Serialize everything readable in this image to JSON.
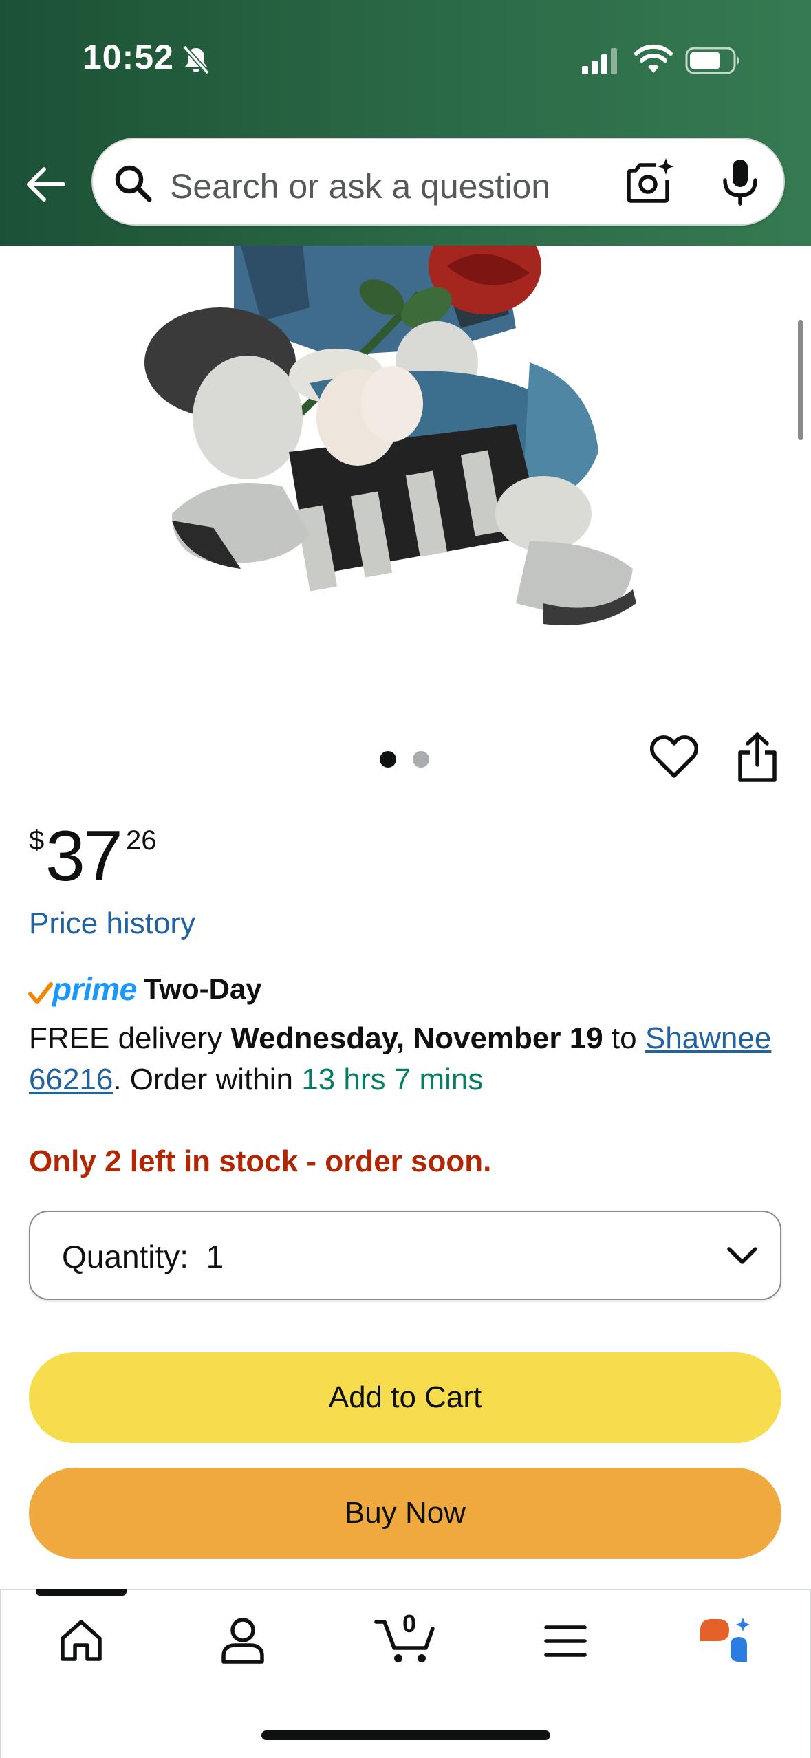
{
  "status_bar": {
    "time": "10:52"
  },
  "search": {
    "placeholder": "Search or ask a question"
  },
  "product": {
    "image_alt": "figurine",
    "carousel": {
      "pages": 2,
      "current": 1
    }
  },
  "price": {
    "symbol": "$",
    "whole": "37",
    "fraction": "26"
  },
  "price_history_link": "Price history",
  "prime": {
    "brand": "prime",
    "type": "Two-Day"
  },
  "delivery": {
    "prefix": "FREE delivery",
    "date": "Wednesday, November 19",
    "to": "to",
    "location": "Shawnee 66216",
    "order_within": ". Order within",
    "countdown": "13 hrs 7 mins"
  },
  "stock_message": "Only 2 left in stock - order soon.",
  "quantity": {
    "label": "Quantity:",
    "value": "1"
  },
  "buttons": {
    "add_to_cart": "Add to Cart",
    "buy_now": "Buy Now"
  },
  "bottom_nav": {
    "cart_count": "0",
    "items": [
      "home-icon",
      "account-icon",
      "cart-icon",
      "menu-icon",
      "rufus-icon"
    ]
  },
  "colors": {
    "header_green": "#2b6a47",
    "link_blue": "#2162a1",
    "prime_blue": "#1a98ff",
    "stock_red": "#b12704",
    "countdown_green": "#067d62",
    "add_to_cart_yellow": "#f7dc4d",
    "buy_now_orange": "#f0a93f"
  }
}
